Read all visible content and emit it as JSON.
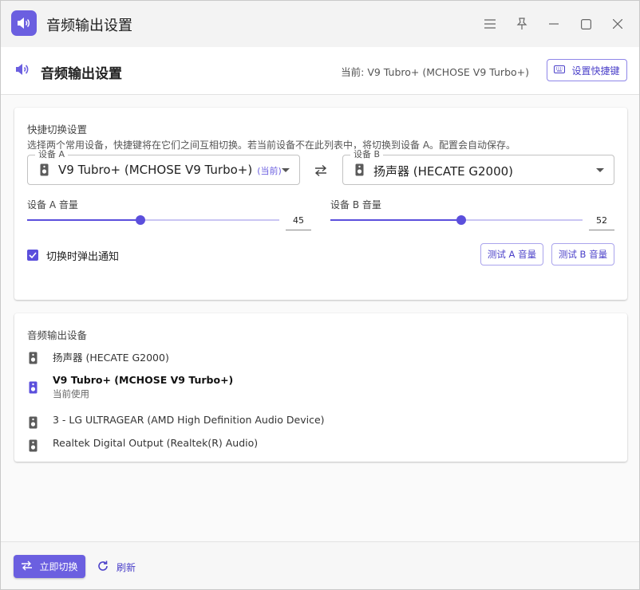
{
  "window": {
    "title": "音频输出设置",
    "controls": [
      "menu-icon",
      "pin-icon",
      "minimize-icon",
      "maximize-icon",
      "close-icon"
    ]
  },
  "header": {
    "title": "音频输出设置",
    "current_device": "当前: V9 Tubro+ (MCHOSE V9 Turbo+)",
    "shortcut_button": "设置快捷键"
  },
  "quick_switch": {
    "title": "快捷切换设置",
    "description": "选择两个常用设备，快捷键将在它们之间互相切换。若当前设备不在此列表中，将切换到设备 A。配置会自动保存。",
    "device_a": {
      "legend": "设备 A",
      "value": "V9 Tubro+ (MCHOSE V9 Turbo+)",
      "tag": "(当前)",
      "icon": "speaker-icon"
    },
    "device_b": {
      "legend": "设备 B",
      "value": "扬声器 (HECATE G2000)",
      "icon": "speaker-icon"
    },
    "volume_a": {
      "label": "设备 A 音量",
      "value": "45",
      "level": 45
    },
    "volume_b": {
      "label": "设备 B 音量",
      "value": "52",
      "level": 52
    },
    "notify": {
      "label": "切换时弹出通知",
      "checked": true
    },
    "test_a": "测试 A 音量",
    "test_b": "测试 B 音量"
  },
  "devices": {
    "title": "音频输出设备",
    "items": [
      {
        "name": "扬声器 (HECATE G2000)",
        "sub": "",
        "active": false
      },
      {
        "name": "V9 Tubro+ (MCHOSE V9 Turbo+)",
        "sub": "当前使用",
        "active": true
      },
      {
        "name": "3 - LG ULTRAGEAR (AMD High Definition Audio Device)",
        "sub": "",
        "active": false
      },
      {
        "name": "Realtek Digital Output (Realtek(R) Audio)",
        "sub": "",
        "active": false
      }
    ]
  },
  "footer": {
    "switch_button": "立即切换",
    "refresh_button": "刷新"
  },
  "colors": {
    "accent": "#6b5fe0",
    "accent_dark": "#4b40c9",
    "slider_track": "#c9c5f3",
    "icon_gray": "#555555"
  }
}
